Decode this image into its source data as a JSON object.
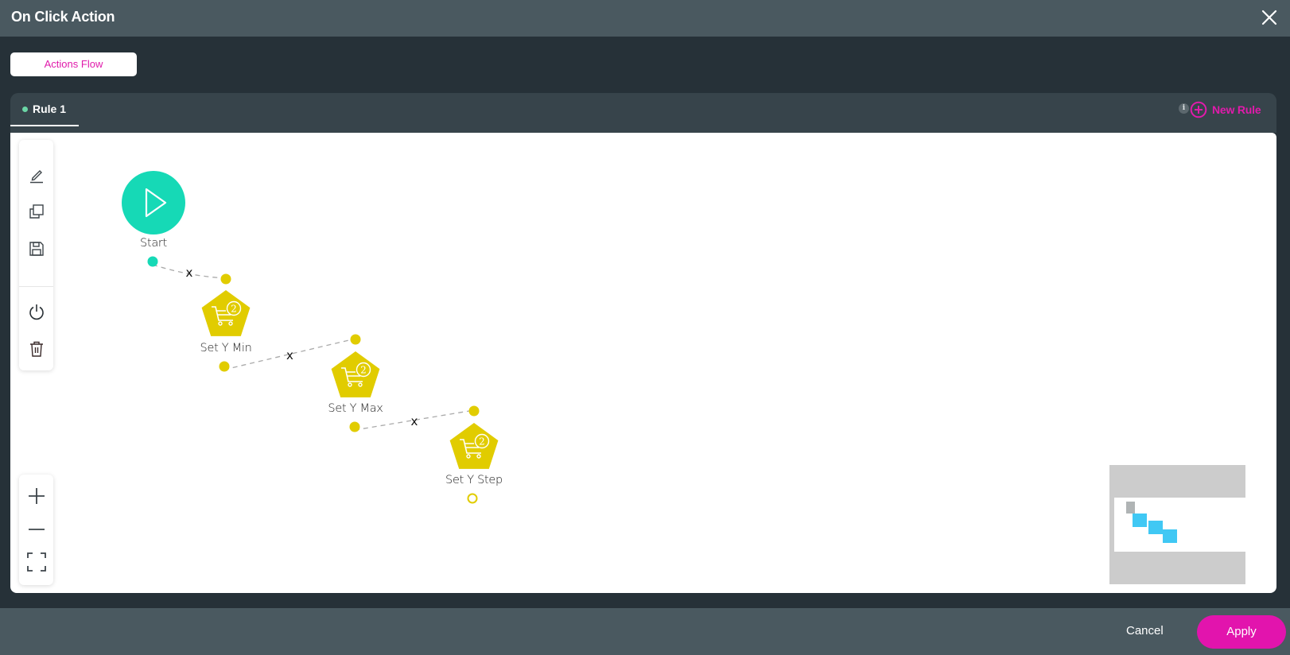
{
  "dialog": {
    "title": "On Click Action",
    "close_icon": "close-icon"
  },
  "tabs": [
    {
      "label": "Actions Flow",
      "active": true
    }
  ],
  "rule_panel": {
    "rules": [
      {
        "label": "Rule 1",
        "active": true,
        "status_color": "#6bd6a6"
      }
    ],
    "info_icon": "info-icon",
    "info_glyph": "i",
    "new_rule_label": "New Rule",
    "accent": "#e01bab"
  },
  "toolbar": {
    "items": [
      "edit-icon",
      "copy-icon",
      "save-icon",
      "power-icon",
      "trash-icon"
    ]
  },
  "zoom_controls": {
    "items": [
      "zoom-in-icon",
      "zoom-out-icon",
      "fit-screen-icon"
    ]
  },
  "flow": {
    "nodes": [
      {
        "id": "start",
        "label": "Start",
        "type": "start",
        "color": "#16d9b6"
      },
      {
        "id": "set-y-min",
        "label": "Set Y Min",
        "type": "action",
        "color": "#e1cc00",
        "badge": "2"
      },
      {
        "id": "set-y-max",
        "label": "Set Y Max",
        "type": "action",
        "color": "#e1cc00",
        "badge": "2"
      },
      {
        "id": "set-y-step",
        "label": "Set Y Step",
        "type": "action",
        "color": "#e1cc00",
        "badge": "2"
      }
    ],
    "edges": [
      {
        "from": "start",
        "to": "set-y-min",
        "remove_label": "x"
      },
      {
        "from": "set-y-min",
        "to": "set-y-max",
        "remove_label": "x"
      },
      {
        "from": "set-y-max",
        "to": "set-y-step",
        "remove_label": "x"
      }
    ]
  },
  "minimap": {
    "colors": {
      "start": "#b0b4b5",
      "action": "#40c8f4"
    }
  },
  "footer": {
    "cancel_label": "Cancel",
    "apply_label": "Apply",
    "apply_color": "#e214ad"
  }
}
